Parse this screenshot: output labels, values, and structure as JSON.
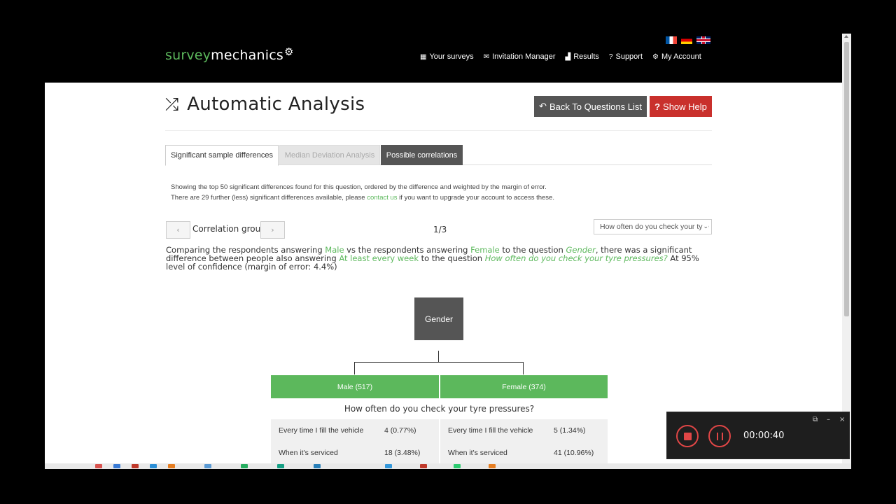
{
  "brand": {
    "part1": "survey",
    "part2": "mechanics",
    "gear": "⚙"
  },
  "languages": [
    "fr",
    "de",
    "gb"
  ],
  "nav": [
    {
      "icon": "▦",
      "icon_name": "table-icon",
      "label": "Your surveys"
    },
    {
      "icon": "✉",
      "icon_name": "envelope-icon",
      "label": "Invitation Manager"
    },
    {
      "icon": "▟",
      "icon_name": "signal-icon",
      "label": "Results"
    },
    {
      "icon": "?",
      "icon_name": "question-icon",
      "label": "Support"
    },
    {
      "icon": "⚙",
      "icon_name": "gear-icon",
      "label": "My Account"
    }
  ],
  "page": {
    "title": "Automatic Analysis",
    "title_icon": "⤮",
    "back_button": "Back To Questions List",
    "back_icon": "↶",
    "help_button": "Show Help",
    "help_icon": "?"
  },
  "tabs": [
    {
      "label": "Significant sample differences",
      "state": "active"
    },
    {
      "label": "Median Deviation Analysis",
      "state": "disabled"
    },
    {
      "label": "Possible correlations",
      "state": "dark"
    }
  ],
  "notice": {
    "line1": "Showing the top 50 significant differences found for this question, ordered by the difference and weighted by the margin of error.",
    "line2_prefix": "There are 29 further (less) significant differences available, please ",
    "line2_link": "contact us",
    "line2_suffix": " if you want to upgrade your account to access these."
  },
  "correlation": {
    "prev": "‹",
    "next": "›",
    "label": "Correlation group",
    "count": "1/3",
    "select_value": "How often do you check your tyre pressures?",
    "select_caret": "⌄"
  },
  "comparison": {
    "t1": "Comparing the respondents answering ",
    "a1": "Male",
    "t2": " vs the respondents answering ",
    "a2": "Female",
    "t3": " to the question ",
    "q1": "Gender",
    "t4": ", there was a significant difference between people also answering ",
    "a3": "At least every week",
    "t5": " to the question ",
    "q2": "How often do you check your tyre pressures?",
    "t6": " At 95% level of confidence (margin of error: 4.4%)"
  },
  "tree": {
    "root": "Gender",
    "branches": [
      {
        "label": "Male (517)"
      },
      {
        "label": "Female (374)"
      }
    ],
    "question": "How often do you check your tyre pressures?",
    "answers_left": [
      {
        "label": "Every time I fill the vehicle",
        "value": "4 (0.77%)"
      },
      {
        "label": "When it's serviced",
        "value": "18 (3.48%)"
      }
    ],
    "answers_right": [
      {
        "label": "Every time I fill the vehicle",
        "value": "5 (1.34%)"
      },
      {
        "label": "When it's serviced",
        "value": "41 (10.96%)"
      }
    ]
  },
  "recorder": {
    "time": "00:00:40",
    "popout_icon": "⧉",
    "minimize_icon": "–",
    "close_icon": "×"
  },
  "colors": {
    "accent_green": "#5cb85c",
    "danger_red": "#c9302c",
    "dark_gray": "#555555"
  }
}
